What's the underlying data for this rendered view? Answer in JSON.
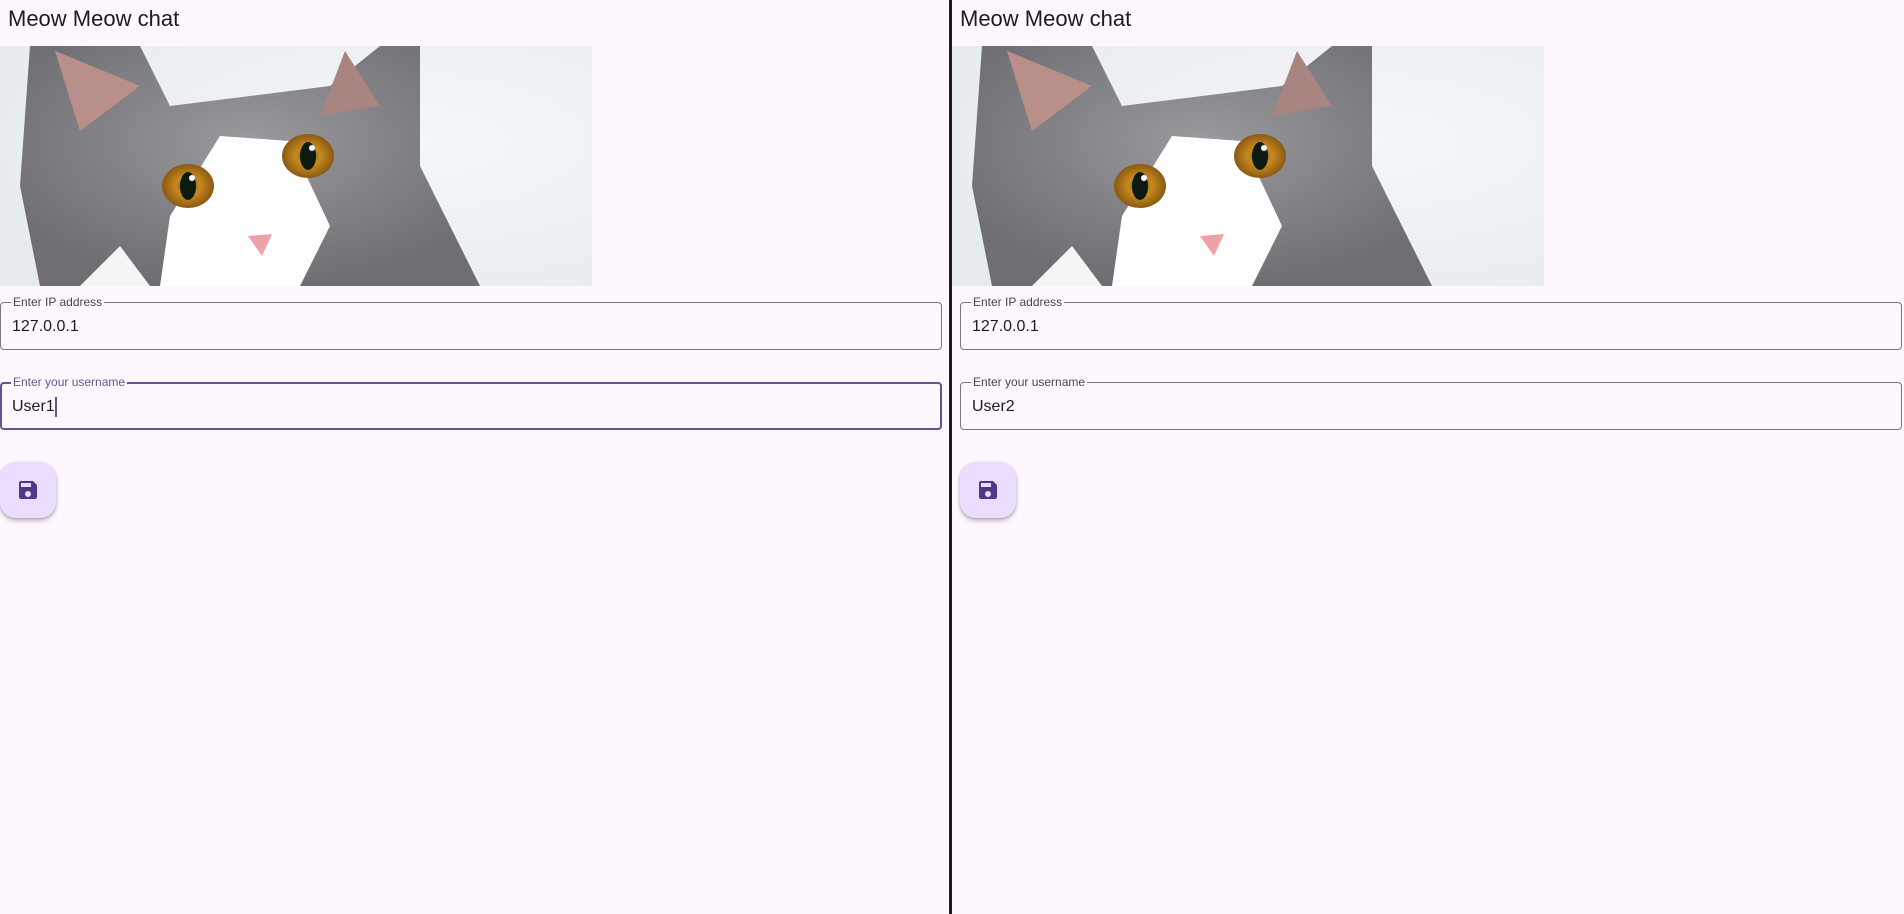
{
  "left_pane": {
    "title": "Meow Meow chat",
    "ip_field": {
      "label": "Enter IP address",
      "value": "127.0.0.1"
    },
    "username_field": {
      "label": "Enter your username",
      "value": "User1",
      "focused": true
    },
    "save_button": {
      "icon": "save-icon"
    }
  },
  "right_pane": {
    "title": "Meow Meow chat",
    "ip_field": {
      "label": "Enter IP address",
      "value": "127.0.0.1"
    },
    "username_field": {
      "label": "Enter your username",
      "value": "User2",
      "focused": false
    },
    "save_button": {
      "icon": "save-icon"
    }
  },
  "colors": {
    "background": "#fef7ff",
    "primary": "#65558f",
    "fab_container": "#eaddff",
    "fab_icon": "#4f378b",
    "outline": "#79747e"
  }
}
